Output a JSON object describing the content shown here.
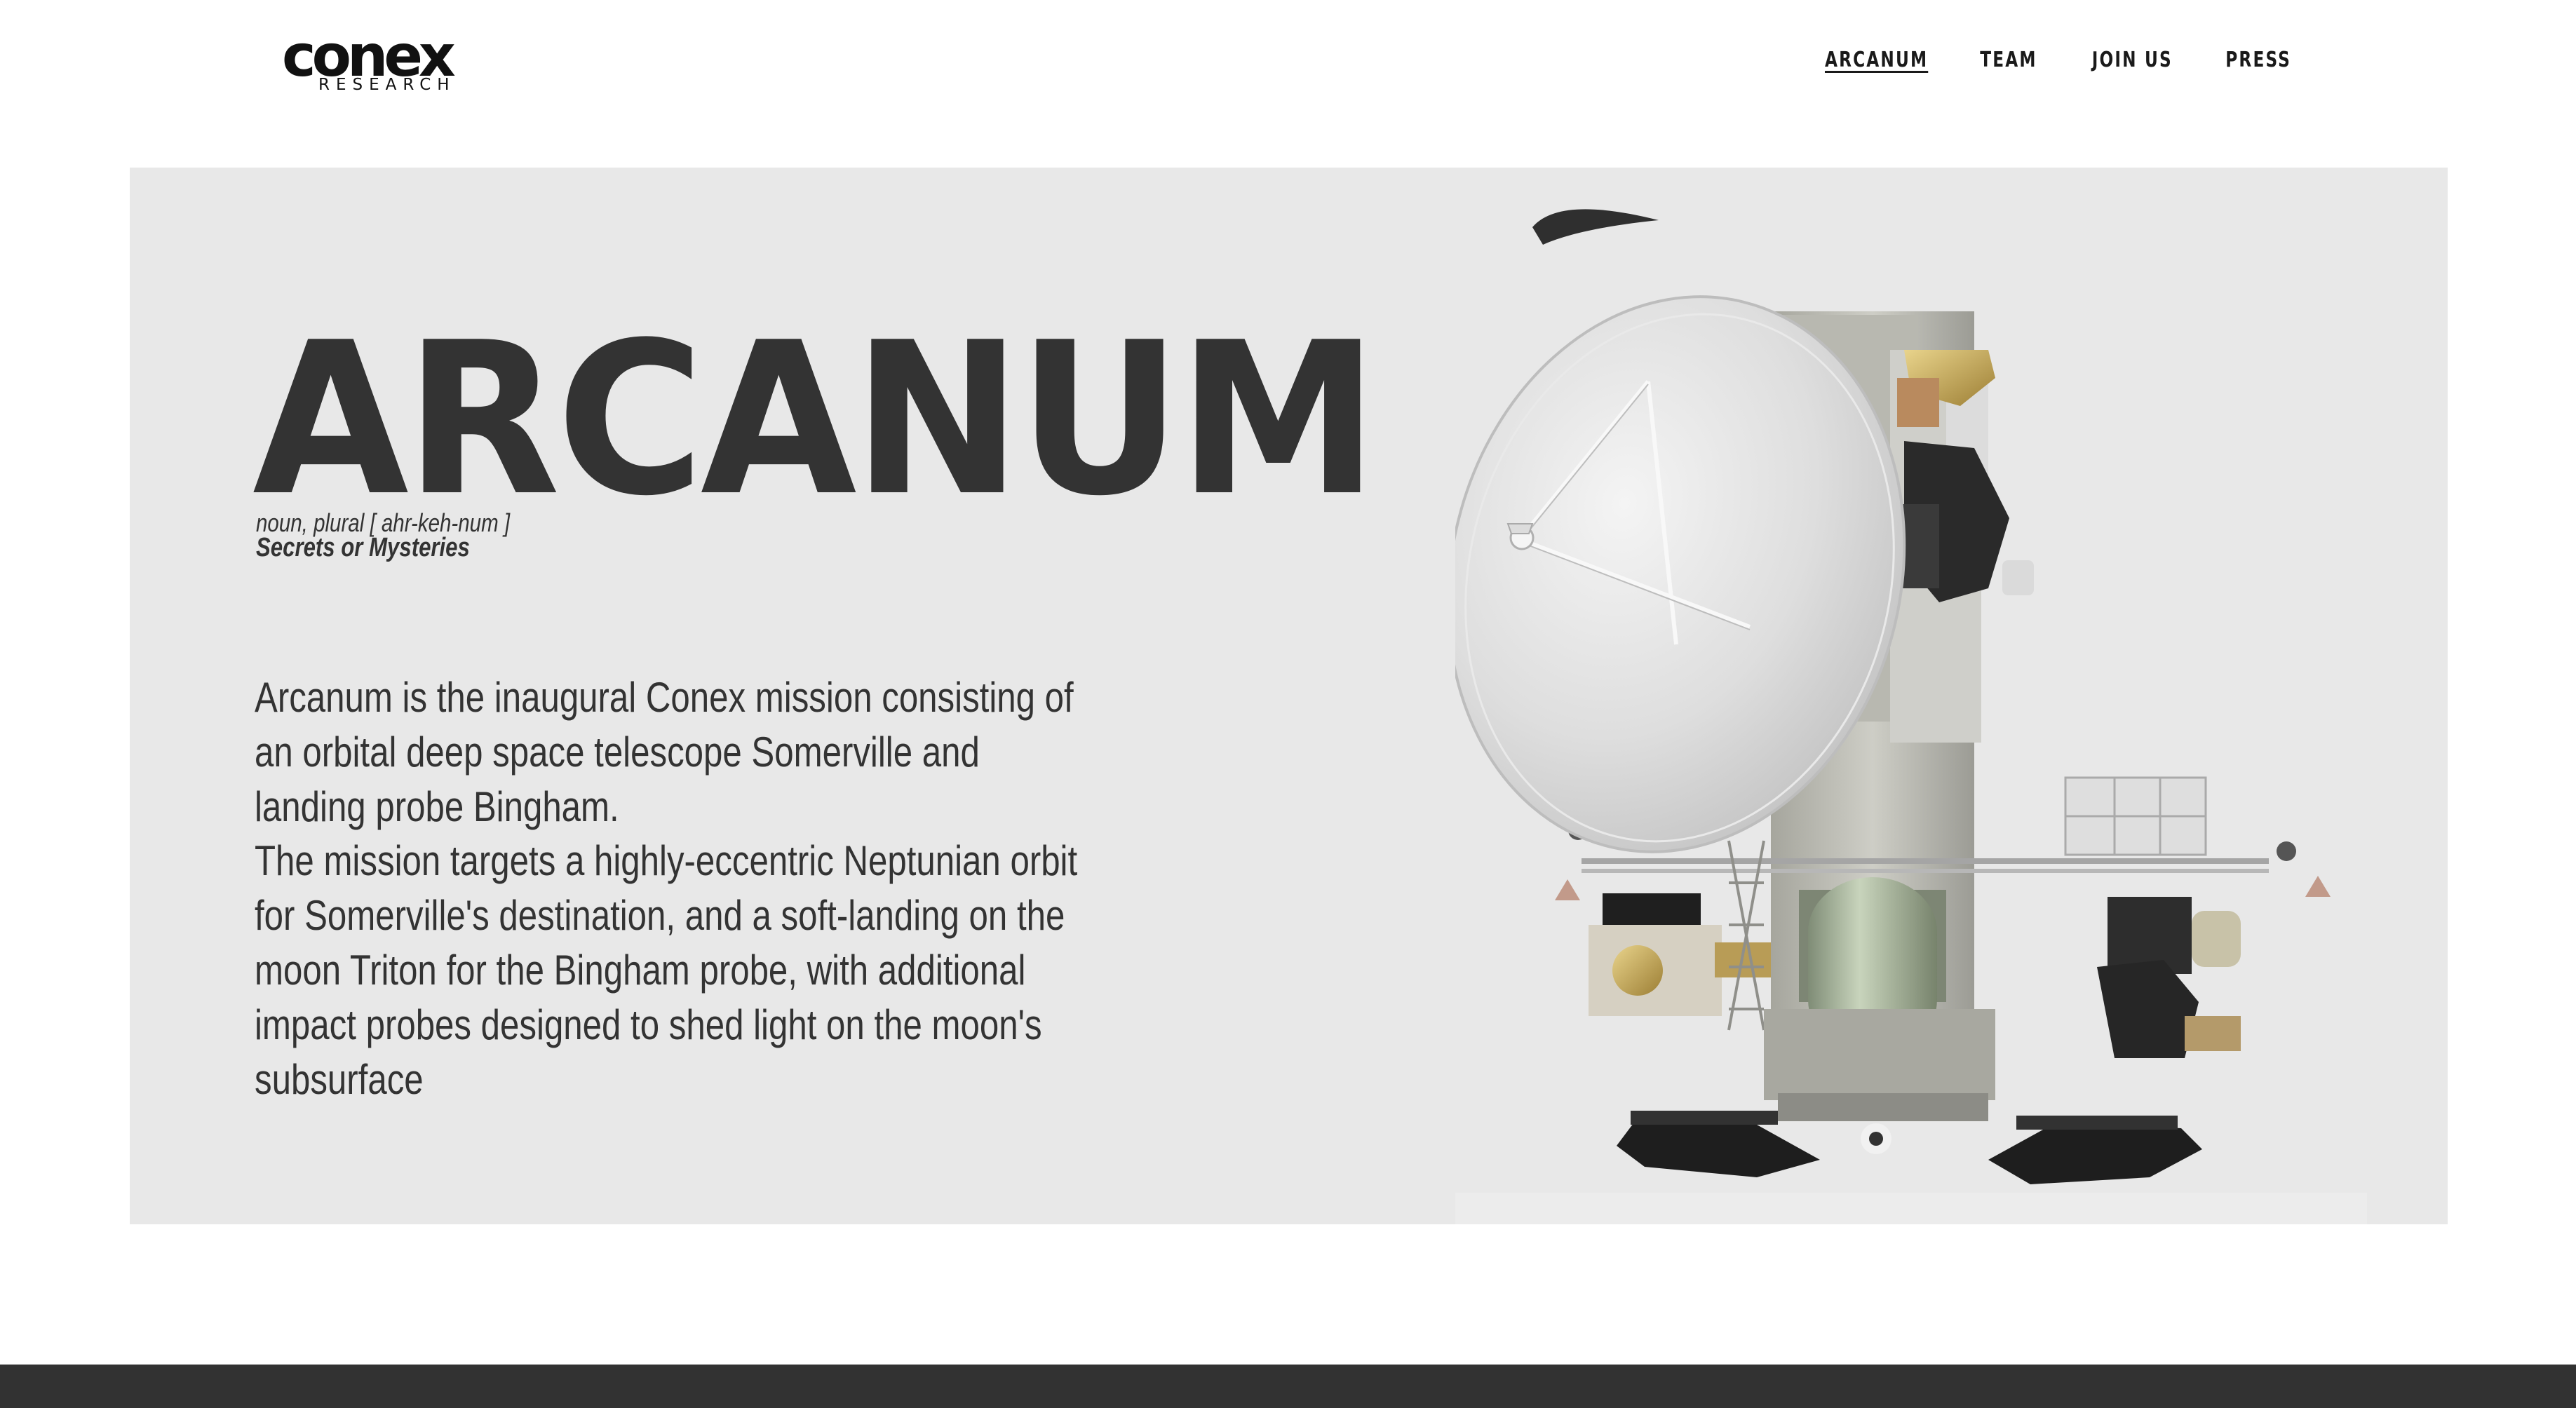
{
  "brand": {
    "logo_word": "conex",
    "logo_sub": "RESEARCH"
  },
  "nav": {
    "items": [
      {
        "label": "ARCANUM",
        "active": true
      },
      {
        "label": "TEAM",
        "active": false
      },
      {
        "label": "JOIN US",
        "active": false
      },
      {
        "label": "PRESS",
        "active": false
      }
    ]
  },
  "hero": {
    "title": "ARCANUM",
    "pronunciation": "noun, plural [ ahr-keh-num ]",
    "definition": "Secrets or Mysteries",
    "paragraph_1": "Arcanum is the inaugural Conex mission consisting of an orbital deep space telescope Somerville and landing probe Bingham.",
    "paragraph_2": "The mission targets a highly-eccentric Neptunian orbit for Somerville's destination, and a soft-landing on the moon Triton for the Bingham probe, with additional impact probes designed to shed light on the moon's subsurface"
  },
  "colors": {
    "hero_background": "#e8e8e8",
    "text": "#333333",
    "footer": "#323232"
  }
}
